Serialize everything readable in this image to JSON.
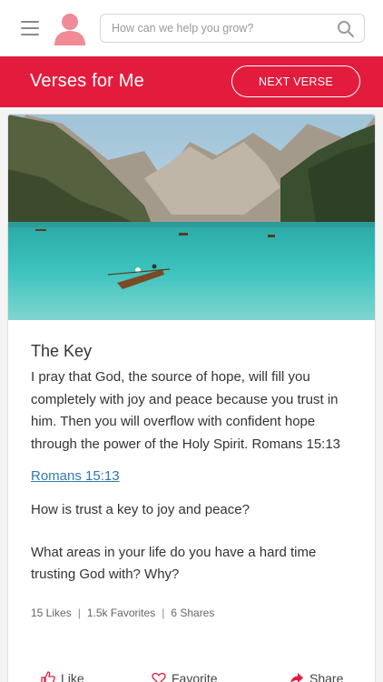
{
  "header": {
    "menu_icon": "hamburger-menu-icon",
    "avatar_icon": "user-avatar-icon",
    "search": {
      "placeholder": "How can we help you grow?",
      "icon": "search-icon"
    }
  },
  "banner": {
    "title": "Verses for Me",
    "next_button": "NEXT VERSE",
    "color": "#e31c3d"
  },
  "card": {
    "title": "The Key",
    "verse": "I pray that God, the source of hope, will fill you completely with joy and peace because you trust in him. Then you will overflow with confident hope through the power of the Holy Spirit. Romans 15:13",
    "reference_link": "Romans 15:13",
    "question_1": "How is trust a key to joy and peace?",
    "question_2": "What areas in your life do you have a hard time trusting God with? Why?",
    "stats": {
      "likes": "15 Likes",
      "favorites": "1.5k Favorites",
      "shares": "6 Shares",
      "separator": "|"
    },
    "actions": {
      "like": "Like",
      "favorite": "Favorite",
      "share": "Share"
    }
  }
}
